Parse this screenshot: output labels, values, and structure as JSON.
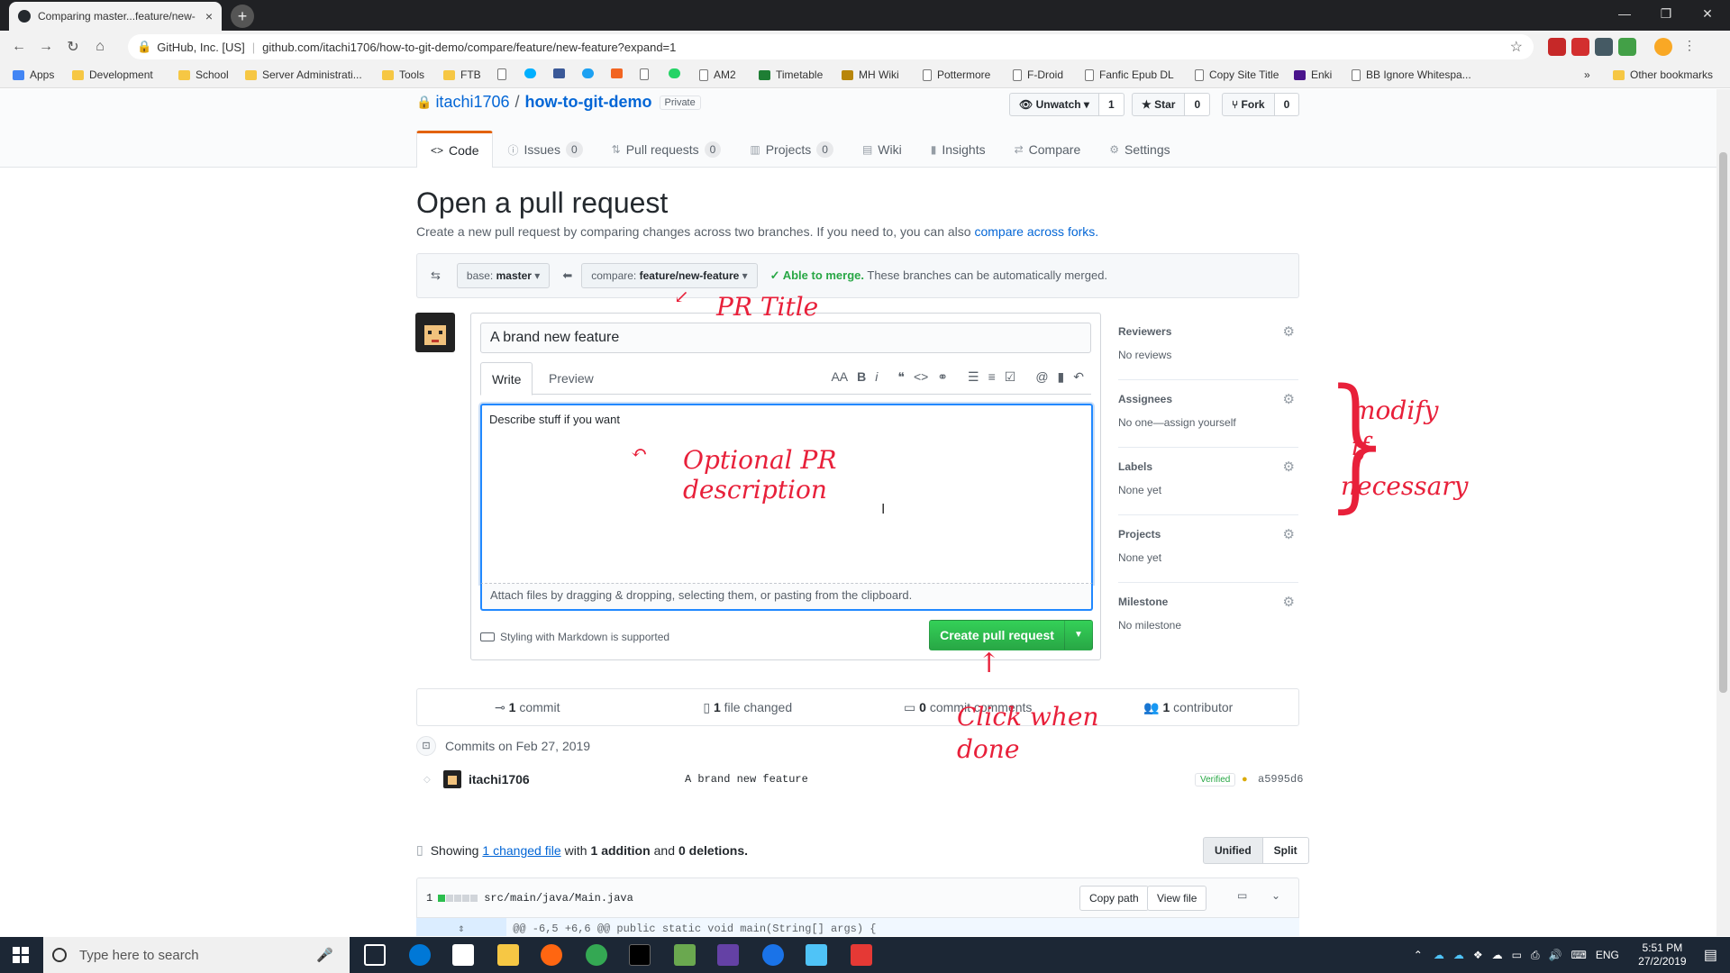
{
  "browser": {
    "tab_title": "Comparing master...feature/new-",
    "tab_close": "×",
    "new_tab": "+",
    "org": "GitHub, Inc. [US]",
    "url": "github.com/itachi1706/how-to-git-demo/compare/feature/new-feature?expand=1",
    "bookmarks": [
      "Apps",
      "Development",
      "School",
      "Server Administrati...",
      "Tools",
      "FTB",
      "AM2",
      "Timetable",
      "MH Wiki",
      "Pottermore",
      "F-Droid",
      "Fanfic Epub DL",
      "Copy Site Title",
      "Enki",
      "BB Ignore Whitespa...",
      "»",
      "Other bookmarks"
    ]
  },
  "repo": {
    "owner": "itachi1706",
    "name": "how-to-git-demo",
    "visibility": "Private",
    "watch_label": "Unwatch ▾",
    "watch_count": "1",
    "star_label": "Star",
    "star_count": "0",
    "fork_label": "Fork",
    "fork_count": "0"
  },
  "nav": {
    "code": "Code",
    "issues": "Issues",
    "issues_count": "0",
    "pulls": "Pull requests",
    "pulls_count": "0",
    "projects": "Projects",
    "projects_count": "0",
    "wiki": "Wiki",
    "insights": "Insights",
    "compare": "Compare",
    "settings": "Settings"
  },
  "header": {
    "title": "Open a pull request",
    "subtitle": "Create a new pull request by comparing changes across two branches. If you need to, you can also",
    "subtitle_link": "compare across forks."
  },
  "range": {
    "base_prefix": "base:",
    "base": "master",
    "compare_prefix": "compare:",
    "compare": "feature/new-feature",
    "merge_status": "Able to merge.",
    "merge_note": "These branches can be automatically merged."
  },
  "composer": {
    "title_value": "A brand new feature",
    "tab_write": "Write",
    "tab_preview": "Preview",
    "body_value": "Describe stuff if you want",
    "attach_text": "Attach files by dragging & dropping, selecting them, or pasting from the clipboard.",
    "markdown_note": "Styling with Markdown is supported",
    "create_label": "Create pull request"
  },
  "sidebar": {
    "items": [
      {
        "heading": "Reviewers",
        "value": "No reviews"
      },
      {
        "heading": "Assignees",
        "value": "No one—assign yourself"
      },
      {
        "heading": "Labels",
        "value": "None yet"
      },
      {
        "heading": "Projects",
        "value": "None yet"
      },
      {
        "heading": "Milestone",
        "value": "No milestone"
      }
    ]
  },
  "summary": {
    "commits_n": "1",
    "commits_label": "commit",
    "files_n": "1",
    "files_label": "file changed",
    "comments_n": "0",
    "comments_label": "commit comments",
    "contrib_n": "1",
    "contrib_label": "contributor"
  },
  "commits": {
    "heading": "Commits on Feb 27, 2019",
    "author": "itachi1706",
    "message": "A brand new feature",
    "verified": "Verified",
    "sha": "a5995d6"
  },
  "diff": {
    "showing": "Showing",
    "changed_link": "1 changed file",
    "with": "with",
    "additions": "1 addition",
    "and": "and",
    "deletions": "0 deletions.",
    "unified": "Unified",
    "split": "Split",
    "file_num": "1",
    "file_path": "src/main/java/Main.java",
    "copy_path": "Copy path",
    "view_file": "View file",
    "hunk": "@@ -6,5 +6,6 @@ public static void main(String[] args) {"
  },
  "annotations": {
    "pr_title": "PR Title",
    "optional1": "Optional PR",
    "optional2": "description",
    "modify1": "modify",
    "modify2": "if",
    "modify3": "necessary",
    "click1": "Click when",
    "click2": "done"
  },
  "taskbar": {
    "search_placeholder": "Type here to search",
    "lang": "ENG",
    "time": "5:51 PM",
    "date": "27/2/2019"
  },
  "colors": {
    "accent": "#0366d6",
    "primary_button": "#28a745",
    "annotation": "#e8203a",
    "tab_underline": "#e36209"
  }
}
